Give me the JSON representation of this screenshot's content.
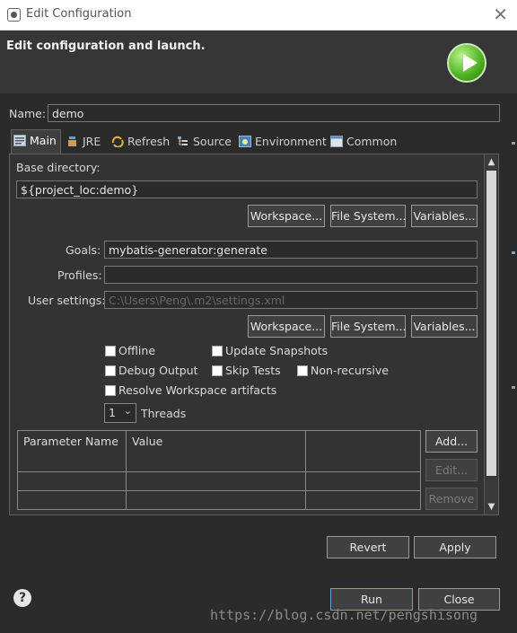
{
  "window": {
    "title": "Edit Configuration",
    "close_glyph": "✕"
  },
  "header": {
    "heading": "Edit configuration and launch.",
    "icon": "run-icon"
  },
  "name": {
    "label": "Name:",
    "value": "demo"
  },
  "tabs": [
    {
      "label": "Main",
      "icon": "main-tab-icon",
      "active": true
    },
    {
      "label": "JRE",
      "icon": "jre-icon"
    },
    {
      "label": "Refresh",
      "icon": "refresh-icon"
    },
    {
      "label": "Source",
      "icon": "source-icon"
    },
    {
      "label": "Environment",
      "icon": "environment-icon"
    },
    {
      "label": "Common",
      "icon": "common-icon"
    }
  ],
  "main": {
    "base_directory": {
      "label": "Base directory:",
      "value": "${project_loc:demo}",
      "buttons": {
        "workspace": "Workspace...",
        "file_system": "File System...",
        "variables": "Variables..."
      }
    },
    "goals": {
      "label": "Goals:",
      "value": "mybatis-generator:generate"
    },
    "profiles": {
      "label": "Profiles:",
      "value": ""
    },
    "user_settings": {
      "label": "User settings:",
      "value": "C:\\Users\\Peng\\.m2\\settings.xml",
      "buttons": {
        "workspace": "Workspace...",
        "file_system": "File System...",
        "variables": "Variables..."
      }
    },
    "options": {
      "offline": "Offline",
      "update_snapshots": "Update Snapshots",
      "debug_output": "Debug Output",
      "skip_tests": "Skip Tests",
      "non_recursive": "Non-recursive",
      "resolve_workspace": "Resolve Workspace artifacts"
    },
    "threads": {
      "value": "1",
      "label": "Threads"
    },
    "parameters": {
      "columns": [
        "Parameter Name",
        "Value"
      ],
      "buttons": {
        "add": "Add...",
        "edit": "Edit...",
        "remove": "Remove"
      }
    }
  },
  "footer": {
    "revert": "Revert",
    "apply": "Apply",
    "run": "Run",
    "close": "Close",
    "help": "?"
  },
  "watermark": "https://blog.csdn.net/pengshisong",
  "colors": {
    "background": "#333333",
    "accent_border": "#6aa2d8",
    "run_icon": "#4caf1f"
  }
}
